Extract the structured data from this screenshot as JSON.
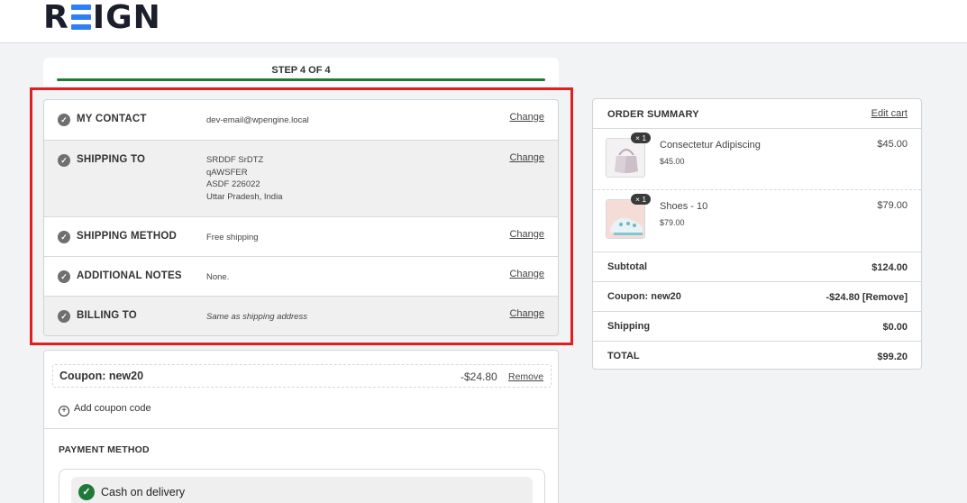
{
  "header": {
    "logo_left": "R",
    "logo_right": "IGN"
  },
  "progress": {
    "step_label": "STEP 4 OF 4",
    "completed_fraction": 1.0,
    "color": "#1f7a3a"
  },
  "review_steps": [
    {
      "label": "MY CONTACT",
      "lines": [
        "dev-email@wpengine.local"
      ],
      "change": "Change"
    },
    {
      "label": "SHIPPING TO",
      "lines": [
        "SRDDF SrDTZ",
        "qAWSFER",
        "ASDF 226022",
        "Uttar Pradesh, India"
      ],
      "change": "Change"
    },
    {
      "label": "SHIPPING METHOD",
      "lines": [
        "Free shipping"
      ],
      "change": "Change"
    },
    {
      "label": "ADDITIONAL NOTES",
      "lines": [
        "None."
      ],
      "change": "Change"
    },
    {
      "label": "BILLING TO",
      "lines": [
        "Same as shipping address"
      ],
      "change": "Change"
    }
  ],
  "coupon": {
    "name": "Coupon: new20",
    "amount": "-$24.80",
    "remove": "Remove",
    "add_label": "Add coupon code"
  },
  "payment": {
    "title": "PAYMENT METHOD",
    "selected_option": "Cash on delivery"
  },
  "summary": {
    "title": "ORDER SUMMARY",
    "edit_cart": "Edit cart",
    "items": [
      {
        "name": "Consectetur Adipiscing",
        "unit_price": "$45.00",
        "price": "$45.00",
        "qty": "× 1",
        "icon": "bag-thumbnail"
      },
      {
        "name": "Shoes - 10",
        "unit_price": "$79.00",
        "price": "$79.00",
        "qty": "× 1",
        "icon": "shoe-thumbnail"
      }
    ],
    "subtotal_label": "Subtotal",
    "subtotal": "$124.00",
    "coupon_label": "Coupon: new20",
    "coupon_value": "-$24.80",
    "coupon_remove": "[Remove]",
    "shipping_label": "Shipping",
    "shipping": "$0.00",
    "total_label": "TOTAL",
    "total": "$99.20"
  },
  "colors": {
    "accent_green": "#1f7a3a",
    "logo_blue": "#2f7ff2",
    "highlight_red": "#e02020"
  }
}
